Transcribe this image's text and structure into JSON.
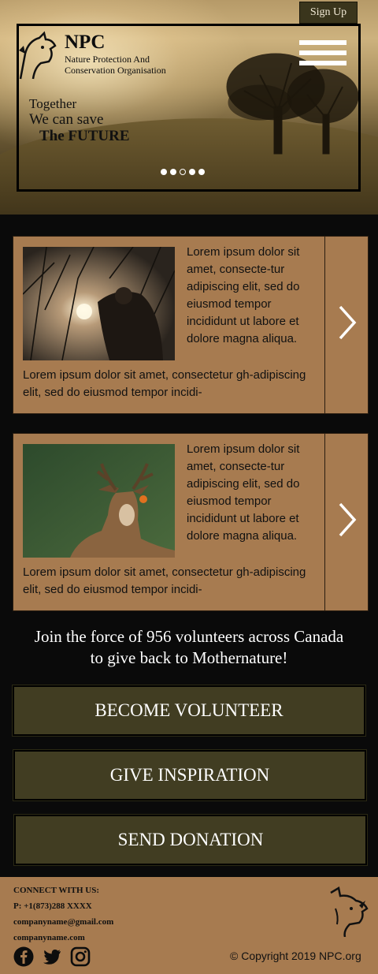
{
  "header": {
    "signup_label": "Sign Up",
    "brand_name": "NPC",
    "brand_sub_1": "Nature Protection And",
    "brand_sub_2": "Conservation Organisation",
    "tagline_1": "Together",
    "tagline_2": "We can save",
    "tagline_3": "The FUTURE",
    "slider_dots": 5,
    "active_dot": 3
  },
  "cards": [
    {
      "image": "forest-worker-photo",
      "side_text": "Lorem ipsum dolor sit amet, consecte-tur adipiscing elit, sed do eiusmod tempor incididunt ut labore et dolore magna aliqua.",
      "bottom_text": "Lorem ipsum dolor sit amet, consectetur gh-adipiscing elit, sed do eiusmod tempor incidi-"
    },
    {
      "image": "deer-photo",
      "side_text": "Lorem ipsum dolor sit amet, consecte-tur adipiscing elit, sed do eiusmod tempor incididunt ut labore et dolore magna aliqua.",
      "bottom_text": "Lorem ipsum dolor sit amet, consectetur gh-adipiscing elit, sed do eiusmod tempor incidi-"
    }
  ],
  "join_text_1": "Join the force of 956 volunteers across Canada",
  "join_text_2": "to give back to Mothernature!",
  "buttons": {
    "volunteer": "BECOME VOLUNTEER",
    "inspiration": "GIVE INSPIRATION",
    "donation": "SEND DONATION"
  },
  "footer": {
    "connect": "CONNECT WITH US:",
    "phone": "P: +1(873)288 XXXX",
    "email": "companyname@gmail.com",
    "website": "companyname.com",
    "copyright": "© Copyright 2019 NPC.org",
    "social_icons": [
      "facebook-icon",
      "twitter-icon",
      "instagram-icon"
    ]
  },
  "colors": {
    "card_bg": "#a77b50",
    "button_bg": "#413d22",
    "page_bg": "#0a0a0a"
  }
}
